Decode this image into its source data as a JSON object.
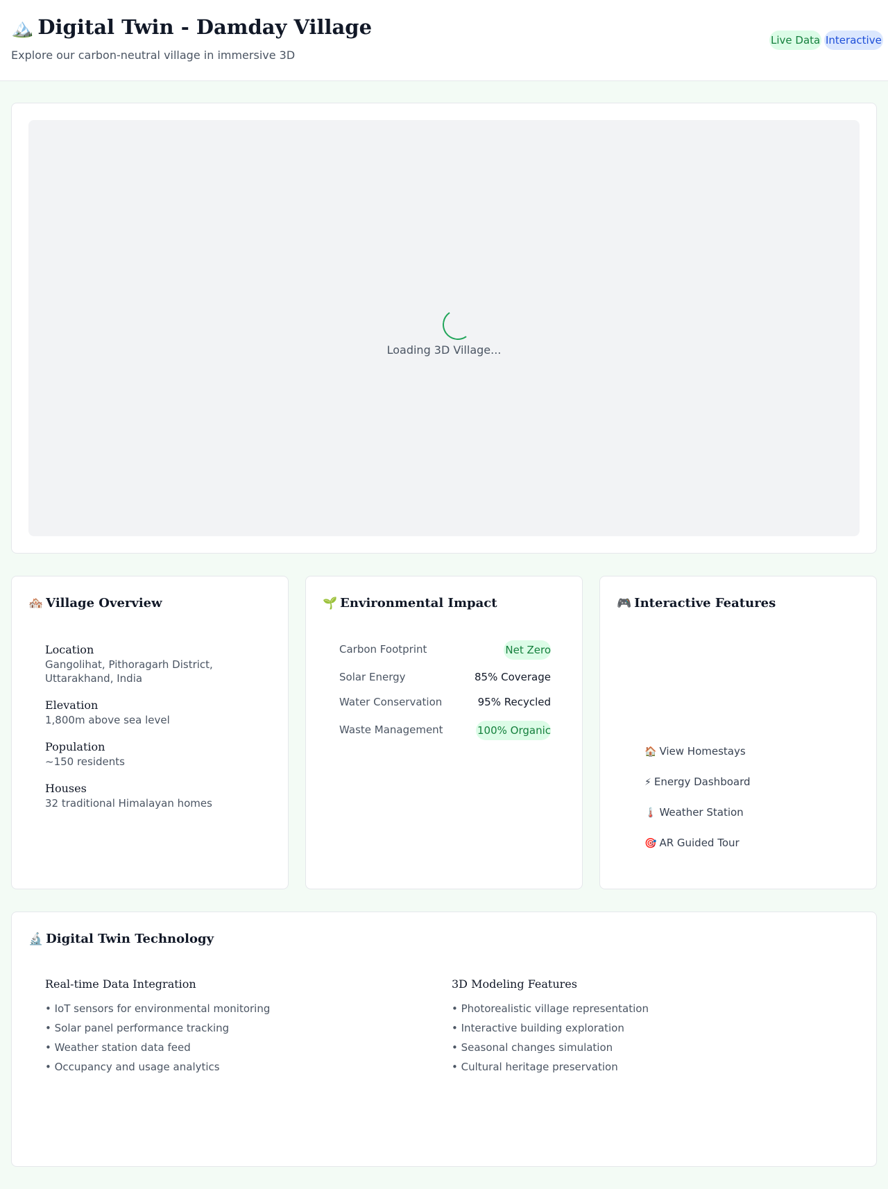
{
  "header": {
    "title_icon": "mountain-icon",
    "title_emoji": "🏔️",
    "title": "Digital Twin - Damday Village",
    "subtitle": "Explore our carbon-neutral village in immersive 3D",
    "badges": [
      "Live Data",
      "Interactive"
    ],
    "colors": {
      "live_bg": "#dcfce7",
      "live_text": "#15803d",
      "interactive_bg": "#dbe7fe",
      "interactive_text": "#1d4ed8"
    }
  },
  "viewer": {
    "loading_text": "Loading 3D Village...",
    "spinner_color": "#22a55a"
  },
  "overview": {
    "icon": "houses-icon",
    "emoji": "🏘️",
    "title": "Village Overview",
    "items": [
      {
        "label": "Location",
        "value": "Gangolihat, Pithoragarh District, Uttarakhand, India"
      },
      {
        "label": "Elevation",
        "value": "1,800m above sea level"
      },
      {
        "label": "Population",
        "value": "~150 residents"
      },
      {
        "label": "Houses",
        "value": "32 traditional Himalayan homes"
      }
    ]
  },
  "environment": {
    "icon": "seedling-icon",
    "emoji": "🌱",
    "title": "Environmental Impact",
    "rows": [
      {
        "label": "Carbon Footprint",
        "value": "Net Zero"
      },
      {
        "label": "Solar Energy",
        "value": "85% Coverage"
      },
      {
        "label": "Water Conservation",
        "value": "95% Recycled"
      },
      {
        "label": "Waste Management",
        "value": "100% Organic"
      }
    ]
  },
  "features": {
    "icon": "gamepad-icon",
    "emoji": "🎮",
    "title": "Interactive Features",
    "items": [
      {
        "emoji": "🏠",
        "icon": "house-icon",
        "label": "View Homestays"
      },
      {
        "emoji": "⚡",
        "icon": "lightning-icon",
        "label": "Energy Dashboard"
      },
      {
        "emoji": "🌡️",
        "icon": "thermometer-icon",
        "label": "Weather Station"
      },
      {
        "emoji": "🎯",
        "icon": "target-icon",
        "label": "AR Guided Tour"
      }
    ]
  },
  "technology": {
    "icon": "microscope-icon",
    "emoji": "🔬",
    "title": "Digital Twin Technology",
    "col1": {
      "title": "Real-time Data Integration",
      "items": [
        "• IoT sensors for environmental monitoring",
        "• Solar panel performance tracking",
        "• Weather station data feed",
        "• Occupancy and usage analytics"
      ]
    },
    "col2": {
      "title": "3D Modeling Features",
      "items": [
        "• Photorealistic village representation",
        "• Interactive building exploration",
        "• Seasonal changes simulation",
        "• Cultural heritage preservation"
      ]
    }
  }
}
